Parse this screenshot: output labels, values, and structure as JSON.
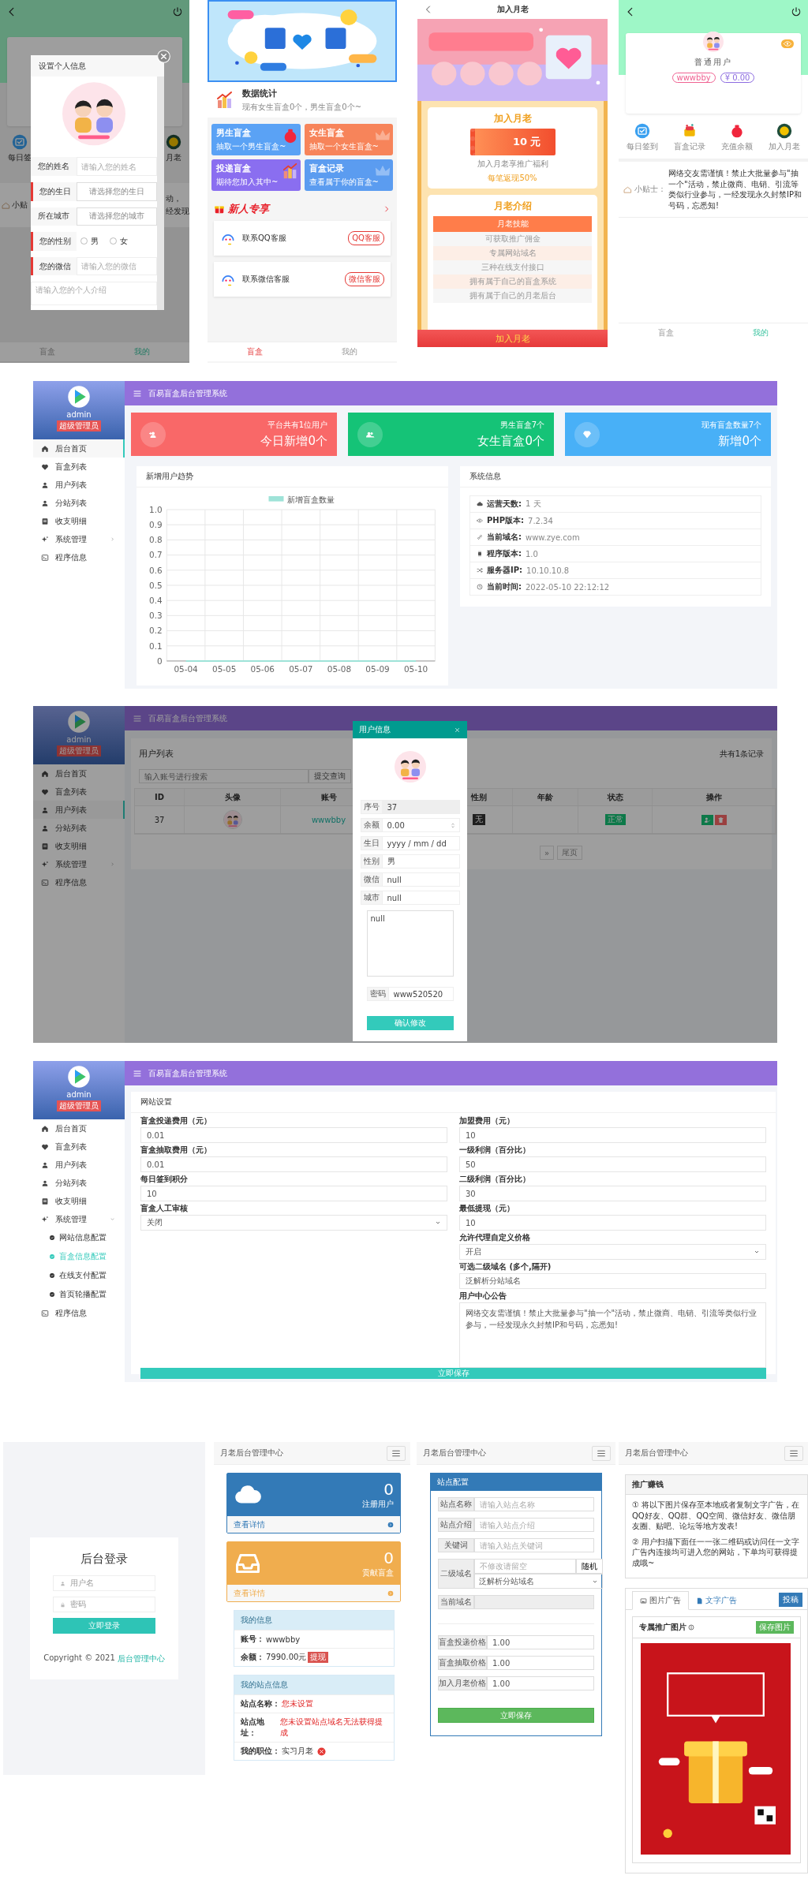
{
  "phone_profile_modal": {
    "background": {
      "left_shortcut": "每日签",
      "right_shortcut": "月老",
      "tip_label": "小贴",
      "tip_fragments": [
        "动，",
        "经发现"
      ],
      "nav": [
        {
          "label": "盲盒",
          "selected": false
        },
        {
          "label": "我的",
          "selected": true
        }
      ]
    },
    "modal": {
      "title": "设置个人信息",
      "fields": [
        {
          "kind": "input",
          "label": "您的姓名",
          "required": false,
          "placeholder": "请输入您的姓名"
        },
        {
          "kind": "select",
          "label": "您的生日",
          "required": true,
          "placeholder": "请选择您的生日"
        },
        {
          "kind": "select",
          "label": "所在城市",
          "required": false,
          "placeholder": "请选择您的城市"
        },
        {
          "kind": "radio",
          "label": "您的性别",
          "required": true,
          "options": [
            {
              "label": "男",
              "checked": false
            },
            {
              "label": "女",
              "checked": false
            }
          ]
        },
        {
          "kind": "input",
          "label": "您的微信",
          "required": true,
          "placeholder": "请输入您的微信"
        }
      ],
      "intro_placeholder": "请输入您的个人介绍"
    }
  },
  "phone_home": {
    "stats": {
      "title": "数据统计",
      "text": "现有女生盲盒0个，男生盲盒0个~"
    },
    "tiles": [
      {
        "title": "男生盲盒",
        "subtitle": "抽取一个男生盲盒~",
        "color": "#5aa2f5"
      },
      {
        "title": "女生盲盒",
        "subtitle": "抽取一个女生盲盒~",
        "color": "#f7845a"
      },
      {
        "title": "投递盲盒",
        "subtitle": "期待您加入其中~",
        "color": "#8a6ef0"
      },
      {
        "title": "盲盒记录",
        "subtitle": "查看属于你的盲盒~",
        "color": "#5b9cf0"
      }
    ],
    "section_title": "新人专享",
    "contacts": [
      {
        "label": "联系QQ客服",
        "action": "QQ客服"
      },
      {
        "label": "联系微信客服",
        "action": "微信客服"
      }
    ],
    "nav": [
      {
        "label": "盲盒",
        "selected": true
      },
      {
        "label": "我的",
        "selected": false
      }
    ]
  },
  "phone_join": {
    "title": "加入月老",
    "offer": {
      "title": "加入月老",
      "price": "10 元",
      "text": "加入月老享推广福利",
      "highlight": "每笔返现50%"
    },
    "intro": {
      "title": "月老介绍",
      "header": "月老技能",
      "rows": [
        "可获取推广佣金",
        "专属网站域名",
        "三种在线支付接口",
        "拥有属于自己的盲盒系统",
        "拥有属于自己的月老后台"
      ]
    },
    "button": "加入月老"
  },
  "phone_profile": {
    "name": "普通用户",
    "tags": [
      "wwwbby",
      "¥ 0.00"
    ],
    "shortcuts": [
      "每日签到",
      "盲盒记录",
      "充值余额",
      "加入月老"
    ],
    "tip_label": "小贴士：",
    "tip": "网络交友需谨慎！禁止大批量参与\"抽一个\"活动，禁止微商、电销、引流等类似行业参与，一经发现永久封禁IP和号码，忘悉知!",
    "nav": [
      {
        "label": "盲盒",
        "selected": false
      },
      {
        "label": "我的",
        "selected": true
      }
    ]
  },
  "admin_dashboard": {
    "title": "百易盲盒后台管理系统",
    "sidebar": {
      "user": "admin",
      "role": "超级管理员",
      "items": [
        {
          "kind": "link",
          "label": "后台首页",
          "selected": true
        },
        {
          "kind": "link",
          "label": "盲盒列表",
          "selected": false
        },
        {
          "kind": "link",
          "label": "用户列表",
          "selected": false
        },
        {
          "kind": "link",
          "label": "分站列表",
          "selected": false
        },
        {
          "kind": "link",
          "label": "收支明细",
          "selected": false
        },
        {
          "kind": "group",
          "label": "系统管理",
          "selected": false,
          "expanded": false
        },
        {
          "kind": "link",
          "label": "程序信息",
          "selected": false
        }
      ]
    },
    "stats": [
      {
        "caption": "平台共有1位用户",
        "value": "今日新增0个",
        "color": "#f96868"
      },
      {
        "caption": "男生盲盒7个",
        "value": "女生盲盒0个",
        "color": "#15c377"
      },
      {
        "caption": "现有盲盒数量7个",
        "value": "新增0个",
        "color": "#48b0f7"
      }
    ],
    "chart": {
      "title": "新增用户趋势",
      "chart_data": {
        "type": "line",
        "categories": [
          "05-04",
          "05-05",
          "05-06",
          "05-07",
          "05-08",
          "05-09",
          "05-10"
        ],
        "series": [
          {
            "name": "新增盲盒数量",
            "color": "#9ee3d8",
            "values": [
              0,
              0,
              0,
              0,
              0,
              0,
              0
            ]
          }
        ],
        "ylim": [
          0,
          1
        ],
        "grid": true,
        "yticks": [
          0,
          0.1,
          0.2,
          0.3,
          0.4,
          0.5,
          0.6,
          0.7,
          0.8,
          0.9,
          {
            "value": 1,
            "label": "1.0"
          }
        ]
      }
    },
    "system": {
      "title": "系统信息",
      "rows": [
        {
          "label": "运营天数:",
          "value": "1 天"
        },
        {
          "label": "PHP版本:",
          "value": "7.2.34"
        },
        {
          "label": "当前域名:",
          "value": "www.zye.com"
        },
        {
          "label": "程序版本:",
          "value": "1.0"
        },
        {
          "label": "服务器IP:",
          "value": "10.10.10.8"
        },
        {
          "label": "当前时间:",
          "value": "2022-05-10 22:12:12"
        }
      ]
    }
  },
  "admin_users": {
    "title": "百易盲盒后台管理系统",
    "sidebar": {
      "user": "admin",
      "role": "超级管理员",
      "items": [
        {
          "kind": "link",
          "label": "后台首页",
          "selected": false
        },
        {
          "kind": "link",
          "label": "盲盒列表",
          "selected": false
        },
        {
          "kind": "link",
          "label": "用户列表",
          "selected": true
        },
        {
          "kind": "link",
          "label": "分站列表",
          "selected": false
        },
        {
          "kind": "link",
          "label": "收支明细",
          "selected": false
        },
        {
          "kind": "group",
          "label": "系统管理",
          "selected": false,
          "expanded": false
        },
        {
          "kind": "link",
          "label": "程序信息",
          "selected": false
        }
      ]
    },
    "panel_title": "用户列表",
    "count": "共有1条记录",
    "search_placeholder": "输入账号进行搜索",
    "search_button": "提交查询",
    "columns": [
      "ID",
      "头像",
      "账号",
      "性别",
      "年龄",
      "状态",
      "操作"
    ],
    "rows": [
      {
        "id": "37",
        "account": "wwwbby",
        "gender": "无",
        "status": "正常"
      }
    ],
    "pagination": [
      "»",
      "尾页"
    ],
    "modal": {
      "title": "用户信息",
      "fields": [
        {
          "kind": "text",
          "label": "序号",
          "value": "37",
          "disabled": true
        },
        {
          "kind": "number",
          "label": "余额",
          "value": "0.00",
          "disabled": false
        },
        {
          "kind": "text",
          "label": "生日",
          "value": "yyyy / mm / dd",
          "disabled": false
        },
        {
          "kind": "text",
          "label": "性别",
          "value": "男",
          "disabled": false
        },
        {
          "kind": "text",
          "label": "微信",
          "value": "null",
          "disabled": false
        },
        {
          "kind": "text",
          "label": "城市",
          "value": "null",
          "disabled": false
        }
      ],
      "intro": "null",
      "password_label": "密码",
      "password": "www520520",
      "button": "确认修改"
    }
  },
  "admin_settings": {
    "title": "百易盲盒后台管理系统",
    "sidebar": {
      "user": "admin",
      "role": "超级管理员",
      "items": [
        {
          "kind": "link",
          "label": "后台首页",
          "selected": false
        },
        {
          "kind": "link",
          "label": "盲盒列表",
          "selected": false
        },
        {
          "kind": "link",
          "label": "用户列表",
          "selected": false
        },
        {
          "kind": "link",
          "label": "分站列表",
          "selected": false
        },
        {
          "kind": "link",
          "label": "收支明细",
          "selected": false
        },
        {
          "kind": "group",
          "label": "系统管理",
          "selected": false,
          "expanded": true,
          "children": [
            {
              "label": "网站信息配置",
              "selected": false
            },
            {
              "label": "盲盒信息配置",
              "selected": true
            },
            {
              "label": "在线支付配置",
              "selected": false
            },
            {
              "label": "首页轮播配置",
              "selected": false
            }
          ]
        },
        {
          "kind": "link",
          "label": "程序信息",
          "selected": false
        }
      ]
    },
    "panel_title": "网站设置",
    "left_fields": [
      {
        "kind": "input",
        "label": "盲盒投递费用（元）",
        "value": "0.01"
      },
      {
        "kind": "input",
        "label": "盲盒抽取费用（元）",
        "value": "0.01"
      },
      {
        "kind": "input",
        "label": "每日签到积分",
        "value": "10"
      },
      {
        "kind": "select",
        "label": "盲盒人工审核",
        "value": "关闭"
      }
    ],
    "right_fields": [
      {
        "kind": "input",
        "label": "加盟费用（元）",
        "value": "10"
      },
      {
        "kind": "input",
        "label": "一级利润（百分比）",
        "value": "50"
      },
      {
        "kind": "input",
        "label": "二级利润（百分比）",
        "value": "30"
      },
      {
        "kind": "input",
        "label": "最低提现（元）",
        "value": "10"
      },
      {
        "kind": "select",
        "label": "允许代理自定义价格",
        "value": "开启"
      },
      {
        "kind": "input",
        "label": "可选二级域名 (多个,隔开)",
        "value": "泛解析分站域名"
      },
      {
        "kind": "textarea",
        "label": "用户中心公告",
        "value": "网络交友需谨慎！禁止大批量参与\"抽一个\"活动，禁止微商、电销、引流等类似行业参与，一经发现永久封禁IP和号码，忘悉知!"
      }
    ],
    "button": "立即保存"
  },
  "login": {
    "title": "后台登录",
    "username_placeholder": "用户名",
    "password_placeholder": "密码",
    "button": "立即登录",
    "copyright": "Copyright © 2021",
    "copyright_link": "后台管理中心"
  },
  "agent_home": {
    "title": "月老后台管理中心",
    "cards": [
      {
        "value": "0",
        "label": "注册用户",
        "link": "查看详情",
        "color": "#337ab7"
      },
      {
        "value": "0",
        "label": "贡献盲盒",
        "link": "查看详情",
        "color": "#f0ad4e"
      }
    ],
    "my_info": {
      "title": "我的信息",
      "rows": [
        {
          "label": "账号：",
          "value": "wwwbby",
          "alert": false
        },
        {
          "label": "余额：",
          "value": "7990.00元",
          "alert": false,
          "action": "提现"
        }
      ]
    },
    "site_info": {
      "title": "我的站点信息",
      "rows": [
        {
          "label": "站点名称：",
          "value": "您未设置",
          "alert": true
        },
        {
          "label": "站点地址：",
          "value": "您未设置站点域名无法获得提成",
          "alert": true
        },
        {
          "label": "我的职位：",
          "value": "实习月老",
          "alert": false
        }
      ]
    }
  },
  "agent_site": {
    "title": "月老后台管理中心",
    "panel_title": "站点配置",
    "fields": [
      {
        "kind": "input",
        "label": "站点名称",
        "placeholder": "请输入站点名称"
      },
      {
        "kind": "input",
        "label": "站点介绍",
        "placeholder": "请输入站点介绍"
      },
      {
        "kind": "input",
        "label": "关键词",
        "placeholder": "请输入站点关键词"
      },
      {
        "kind": "domain",
        "label": "二级域名",
        "placeholder": "不修改请留空",
        "addon": "随机",
        "select": "泛解析分站域名"
      },
      {
        "kind": "readonly",
        "label": "当前域名"
      }
    ],
    "prices": [
      {
        "label": "盲盒投递价格",
        "value": "1.00"
      },
      {
        "label": "盲盒抽取价格",
        "value": "1.00"
      },
      {
        "label": "加入月老价格",
        "value": "1.00"
      }
    ],
    "button": "立即保存"
  },
  "agent_promo": {
    "title": "月老后台管理中心",
    "panel_title": "推广赚钱",
    "tips": [
      "① 将以下图片保存至本地或者复制文字广告，在QQ好友、QQ群、QQ空间、微信好友、微信朋友圈、贴吧、论坛等地方发表!",
      "② 用户扫描下面任一一张二维码或访问任一文字广告内连接均可进入您的网站，下单均可获得提成哦~"
    ],
    "tabs": [
      {
        "label": "图片广告",
        "selected": true
      },
      {
        "label": "文字广告",
        "selected": false
      }
    ],
    "submit": "投稿",
    "image_title": "专属推广图片",
    "save": "保存图片"
  }
}
